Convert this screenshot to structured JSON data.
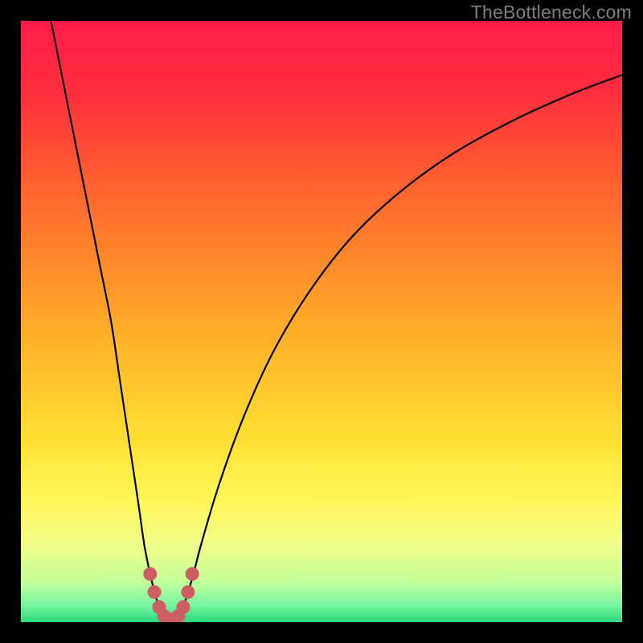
{
  "watermark": "TheBottleneck.com",
  "colors": {
    "frame": "#000000",
    "watermark": "#7e7e7e",
    "curve": "#000000",
    "markers_fill": "#cd5f64",
    "markers_stroke": "#cd5f64",
    "gradient_stops": [
      {
        "offset": 0.0,
        "color": "#ff1b4a"
      },
      {
        "offset": 0.12,
        "color": "#ff2f3e"
      },
      {
        "offset": 0.25,
        "color": "#ff5a30"
      },
      {
        "offset": 0.4,
        "color": "#ff8a2a"
      },
      {
        "offset": 0.55,
        "color": "#ffb72a"
      },
      {
        "offset": 0.7,
        "color": "#ffe033"
      },
      {
        "offset": 0.8,
        "color": "#fff85a"
      },
      {
        "offset": 0.87,
        "color": "#f2ff8a"
      },
      {
        "offset": 0.93,
        "color": "#c7ff9a"
      },
      {
        "offset": 0.97,
        "color": "#7cf7a0"
      },
      {
        "offset": 1.0,
        "color": "#2bd980"
      }
    ]
  },
  "chart_data": {
    "type": "line",
    "title": "",
    "xlabel": "",
    "ylabel": "",
    "xlim": [
      0,
      100
    ],
    "ylim": [
      0,
      100
    ],
    "curve": {
      "note": "V-shaped bottleneck curve. y is bottleneck % (0 at bottom, 100 at top). x is horizontal position % across plot.",
      "points": [
        {
          "x": 5.0,
          "y": 100.0
        },
        {
          "x": 7.0,
          "y": 90.0
        },
        {
          "x": 9.0,
          "y": 80.0
        },
        {
          "x": 11.0,
          "y": 70.0
        },
        {
          "x": 13.0,
          "y": 60.0
        },
        {
          "x": 15.0,
          "y": 50.0
        },
        {
          "x": 16.5,
          "y": 40.0
        },
        {
          "x": 18.0,
          "y": 30.0
        },
        {
          "x": 19.5,
          "y": 20.0
        },
        {
          "x": 20.5,
          "y": 13.0
        },
        {
          "x": 21.5,
          "y": 8.0
        },
        {
          "x": 22.5,
          "y": 4.0
        },
        {
          "x": 23.5,
          "y": 1.5
        },
        {
          "x": 24.5,
          "y": 0.5
        },
        {
          "x": 25.5,
          "y": 0.5
        },
        {
          "x": 26.5,
          "y": 1.5
        },
        {
          "x": 27.5,
          "y": 4.0
        },
        {
          "x": 28.7,
          "y": 8.0
        },
        {
          "x": 30.0,
          "y": 13.0
        },
        {
          "x": 33.0,
          "y": 23.0
        },
        {
          "x": 37.0,
          "y": 34.0
        },
        {
          "x": 42.0,
          "y": 45.0
        },
        {
          "x": 48.0,
          "y": 55.0
        },
        {
          "x": 55.0,
          "y": 64.0
        },
        {
          "x": 63.0,
          "y": 71.5
        },
        {
          "x": 72.0,
          "y": 78.0
        },
        {
          "x": 82.0,
          "y": 83.5
        },
        {
          "x": 92.0,
          "y": 88.0
        },
        {
          "x": 100.0,
          "y": 91.0
        }
      ]
    },
    "markers": [
      {
        "x": 21.5,
        "y": 8.0
      },
      {
        "x": 22.2,
        "y": 5.0
      },
      {
        "x": 23.0,
        "y": 2.5
      },
      {
        "x": 23.8,
        "y": 1.0
      },
      {
        "x": 24.6,
        "y": 0.5
      },
      {
        "x": 25.4,
        "y": 0.5
      },
      {
        "x": 26.2,
        "y": 1.0
      },
      {
        "x": 27.0,
        "y": 2.5
      },
      {
        "x": 27.8,
        "y": 5.0
      },
      {
        "x": 28.5,
        "y": 8.0
      }
    ],
    "marker_radius_px": 8
  }
}
